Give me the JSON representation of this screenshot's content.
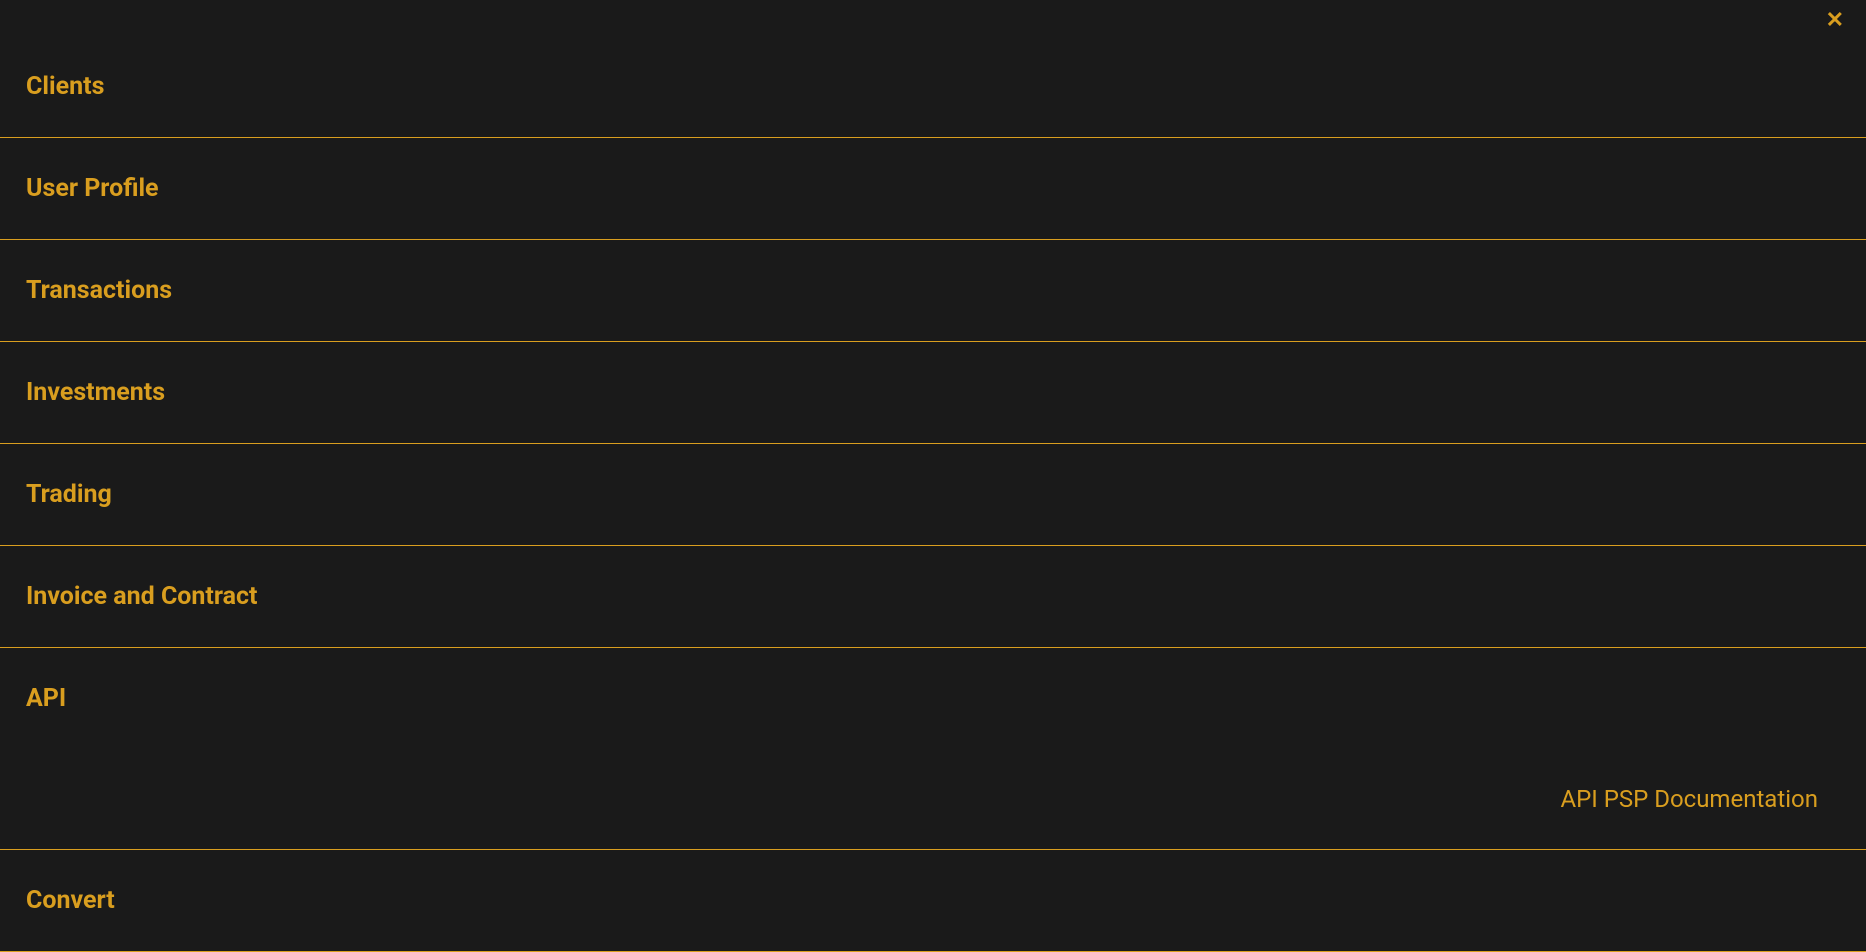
{
  "close_icon": "✕",
  "menu": {
    "items": [
      {
        "label": "Clients"
      },
      {
        "label": "User Profile"
      },
      {
        "label": "Transactions"
      },
      {
        "label": "Investments"
      },
      {
        "label": "Trading"
      },
      {
        "label": "Invoice and Contract"
      },
      {
        "label": "API",
        "sub": {
          "label": "API PSP Documentation"
        }
      },
      {
        "label": "Convert"
      }
    ]
  }
}
